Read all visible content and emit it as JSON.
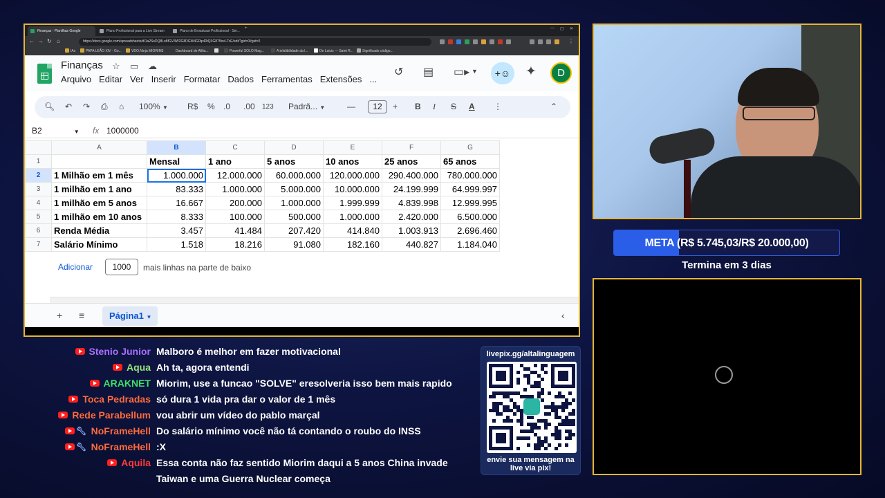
{
  "browser": {
    "tabs": [
      {
        "title": "Finanças - Planilhas Google",
        "active": true
      },
      {
        "title": "Plano Profissional para a Live Stream"
      },
      {
        "title": "Plano de Broadcast Profissional - Sei..."
      }
    ],
    "url": "https://docs.google.com/spreadsheets/d/1a2SsDQ8Lo8fGV3W2G8DGW4G0lp40tQ3G875tn4-TcE/edit?gid=0#gid=0",
    "bookmarks": [
      "IAs",
      "PAPA LEÃO XIV - Go...",
      "VDO.Ninja MIORIM3",
      "Dashboard de Afilia...",
      "Powerful SOLO Mag...",
      "A infalibilidade da l...",
      "De Laicis — Saint R...",
      "Significado código..."
    ]
  },
  "sheets": {
    "title": "Finanças",
    "menu": [
      "Arquivo",
      "Editar",
      "Ver",
      "Inserir",
      "Formatar",
      "Dados",
      "Ferramentas",
      "Extensões",
      "..."
    ],
    "avatar_letter": "D",
    "toolbar": {
      "zoom": "100%",
      "currency": "R$",
      "percent": "%",
      "dec_decrease": ".0",
      "dec_increase": ".00",
      "number_format": "123",
      "font": "Padrã...",
      "font_size": "12",
      "bold": "B",
      "italic": "I",
      "strike": "S",
      "text_color": "A"
    },
    "namebox": "B2",
    "fx": "fx",
    "formula_value": "1000000",
    "columns": [
      "A",
      "B",
      "C",
      "D",
      "E",
      "F",
      "G"
    ],
    "rows": [
      [
        "",
        "Mensal",
        "1 ano",
        "5 anos",
        "10 anos",
        "25 anos",
        "65 anos"
      ],
      [
        "1 Milhão em 1 mês",
        "1.000.000",
        "12.000.000",
        "60.000.000",
        "120.000.000",
        "290.400.000",
        "780.000.000"
      ],
      [
        "1 milhão em 1 ano",
        "83.333",
        "1.000.000",
        "5.000.000",
        "10.000.000",
        "24.199.999",
        "64.999.997"
      ],
      [
        "1 milhão em 5 anos",
        "16.667",
        "200.000",
        "1.000.000",
        "1.999.999",
        "4.839.998",
        "12.999.995"
      ],
      [
        "1 milhão em 10 anos",
        "8.333",
        "100.000",
        "500.000",
        "1.000.000",
        "2.420.000",
        "6.500.000"
      ],
      [
        "Renda Média",
        "3.457",
        "41.484",
        "207.420",
        "414.840",
        "1.003.913",
        "2.696.460"
      ],
      [
        "Salário Mínimo",
        "1.518",
        "18.216",
        "91.080",
        "182.160",
        "440.827",
        "1.184.040"
      ]
    ],
    "add_rows": {
      "button": "Adicionar",
      "count": "1000",
      "suffix": "mais linhas na parte de baixo"
    },
    "sheet_tab": "Página1"
  },
  "overlay": {
    "goal": {
      "text": "META (R$ 5.745,03/R$ 20.000,00)",
      "progress": 0.287,
      "ends": "Termina em 3 dias"
    },
    "qr": {
      "url": "livepix.gg/altalinguagem",
      "caption_1": "envie sua mensagem na",
      "caption_2": "live via pix!"
    },
    "chat": [
      {
        "name": "Stenio Junior",
        "color": "#a970ff",
        "wrench": false,
        "msg": "Malboro é melhor em fazer motivacional"
      },
      {
        "name": "Aqua",
        "color": "#9be27a",
        "wrench": false,
        "msg": "Ah ta, agora entendi"
      },
      {
        "name": "ARAKNET",
        "color": "#3ee06b",
        "wrench": false,
        "msg": "Miorim, use a funcao \"SOLVE\" eresolveria isso bem mais rapido"
      },
      {
        "name": "Toca Pedradas",
        "color": "#ff6b3d",
        "wrench": false,
        "msg": "só dura 1 vida pra dar o valor de 1 mês"
      },
      {
        "name": "Rede Parabellum",
        "color": "#ff6b3d",
        "wrench": false,
        "msg": "vou abrir um vídeo do pablo marçal"
      },
      {
        "name": "NoFrameHell",
        "color": "#ff6b3d",
        "wrench": true,
        "msg": "Do salário mínimo você não tá contando o roubo do INSS"
      },
      {
        "name": "NoFrameHell",
        "color": "#ff6b3d",
        "wrench": true,
        "msg": ":X"
      },
      {
        "name": "Aquila",
        "color": "#ff3b3b",
        "wrench": false,
        "msg": "Essa conta não faz sentido Miorim daqui a 5 anos China invade",
        "msg2": "Taiwan e uma Guerra Nuclear começa"
      }
    ]
  }
}
